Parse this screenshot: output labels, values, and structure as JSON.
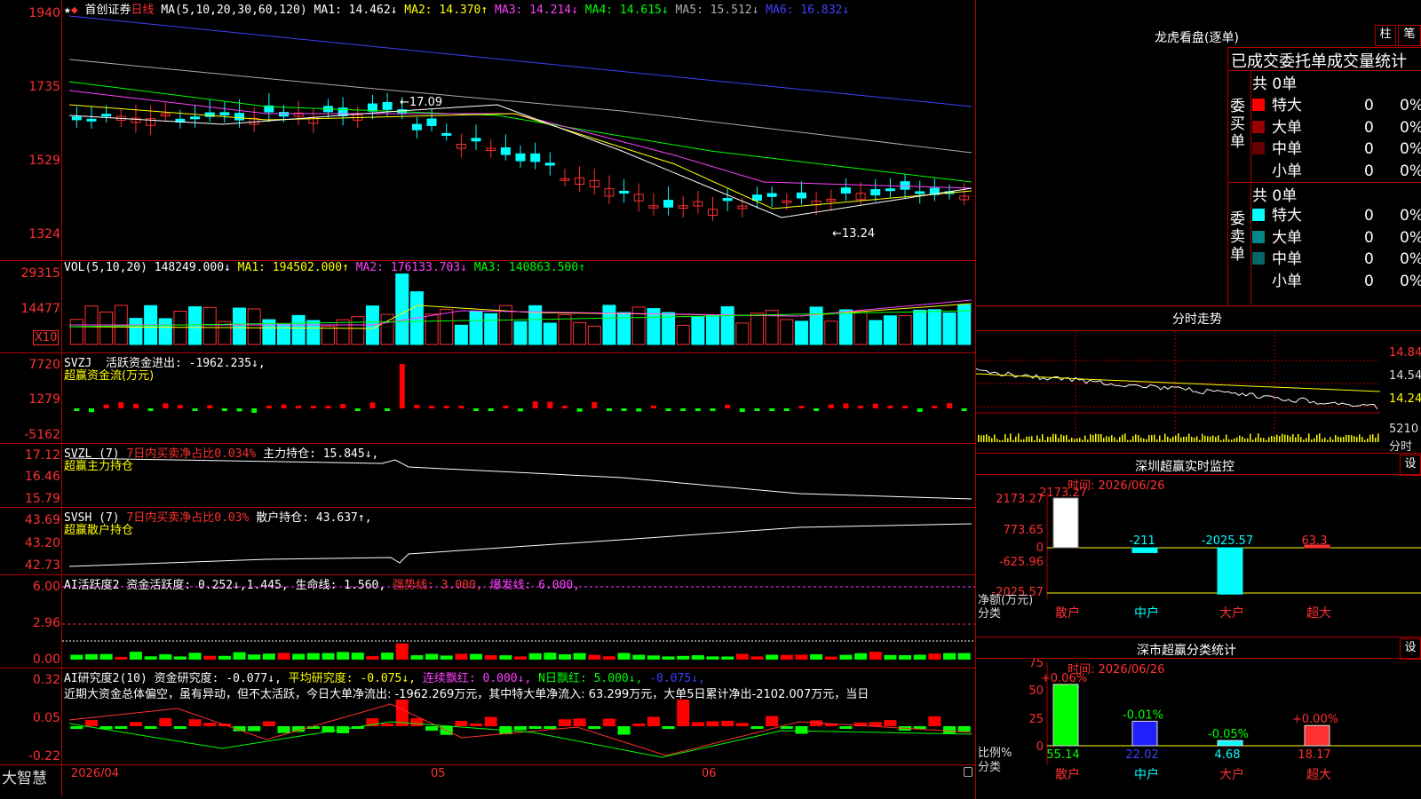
{
  "stock": {
    "name": "首创证券",
    "period": "日线",
    "ma_spec": "MA(5,10,20,30,60,120)",
    "ma": [
      {
        "k": "MA1: 14.462↓",
        "c": "#ffffff"
      },
      {
        "k": "MA2: 14.370↑",
        "c": "#ffff00"
      },
      {
        "k": "MA3: 14.214↓",
        "c": "#ff40ff"
      },
      {
        "k": "MA4: 14.615↓",
        "c": "#00ff00"
      },
      {
        "k": "MA5: 15.512↓",
        "c": "#aaaaaa"
      },
      {
        "k": "MA6: 16.832↓",
        "c": "#4040ff"
      }
    ],
    "yticks": [
      "1940",
      "1735",
      "1529",
      "1324"
    ],
    "high_label": "←17.09",
    "low_label": "←13.24"
  },
  "vol": {
    "hdr": "VOL(5,10,20)",
    "val": "148249.000↓",
    "ma": [
      {
        "k": "MA1: 194502.000↑",
        "c": "#ffff00"
      },
      {
        "k": "MA2: 176133.703↓",
        "c": "#ff40ff"
      },
      {
        "k": "MA3: 140863.500↑",
        "c": "#00ff00"
      }
    ],
    "yticks": [
      "29315",
      "14477"
    ],
    "unit": "X10"
  },
  "svzj": {
    "hdr": "SVZJ",
    "label": "活跃资金进出: -1962.235↓,",
    "sub": "超赢资金流(万元)",
    "yticks": [
      "7720",
      "1279",
      "-5162"
    ]
  },
  "svzl": {
    "hdr": "SVZL (7)",
    "ratio": "7日内买卖净占比0.034%",
    "label": "主力持仓: 15.845↓,",
    "sub": "超赢主力持仓",
    "yticks": [
      "17.12",
      "16.46",
      "15.79"
    ]
  },
  "svsh": {
    "hdr": "SVSH (7)",
    "ratio": "7日内买卖净占比0.03%",
    "label": "散户持仓: 43.637↑,",
    "sub": "超赢散户持仓",
    "yticks": [
      "43.69",
      "43.20",
      "42.73"
    ]
  },
  "ai1": {
    "hdr": "AI活跃度2",
    "a": "资金活跃度: 0.252↓,",
    "b": "1.445,",
    "c": "生命线: 1.560,",
    "d": "强势线: 3.000,",
    "e": "爆发线: 6.000,",
    "yticks": [
      "6.00",
      "2.96",
      "0.00"
    ]
  },
  "ai2": {
    "hdr": "AI研究度2(10)",
    "a": "资金研究度: -0.077↓,",
    "b": "平均研究度: -0.075↓,",
    "c": "连续飘红: 0.000↓,",
    "d": "N日飘红: 5.000↓,",
    "e": "-0.075↓,",
    "comment": "近期大资金总体偏空，虽有异动，但不太活跃，今日大单净流出: -1962.269万元，其中特大单净流入: 63.299万元，大单5日累计净出-2102.007万元，当日",
    "yticks": [
      "0.32",
      "0.05",
      "-0.22"
    ]
  },
  "xaxis": {
    "brand": "大智慧",
    "labels": [
      "2026/04",
      "05",
      "06"
    ]
  },
  "dragon": {
    "title": "龙虎看盘(逐单)",
    "btn1": "柱",
    "btn2": "笔",
    "table_title": "已成交委托单成交量统计",
    "buy_side": "委买单",
    "sell_side": "委卖单",
    "buy_total": "共 0单",
    "sell_total": "共 0单",
    "buy_rows": [
      {
        "n": "特大",
        "v": "0",
        "p": "0%",
        "c": "#ff0000"
      },
      {
        "n": "大单",
        "v": "0",
        "p": "0%",
        "c": "#990000"
      },
      {
        "n": "中单",
        "v": "0",
        "p": "0%",
        "c": "#660000"
      },
      {
        "n": "小单",
        "v": "0",
        "p": "0%",
        "c": "#000000"
      }
    ],
    "sell_rows": [
      {
        "n": "特大",
        "v": "0",
        "p": "0%",
        "c": "#00ffff"
      },
      {
        "n": "大单",
        "v": "0",
        "p": "0%",
        "c": "#008888"
      },
      {
        "n": "中单",
        "v": "0",
        "p": "0%",
        "c": "#006666"
      },
      {
        "n": "小单",
        "v": "0",
        "p": "0%",
        "c": "#000000"
      }
    ]
  },
  "intraday": {
    "title": "分时走势",
    "yticks": [
      "14.84",
      "14.54",
      "14.24",
      "5210"
    ],
    "xl": "分时"
  },
  "monitor": {
    "title": "深圳超赢实时监控",
    "btn": "设",
    "time": "时间: 2026/06/26",
    "yticks": [
      "2173.27",
      "773.65",
      "0",
      "-625.96",
      "-2025.57"
    ],
    "ylabel": "净额(万元)",
    "xlabel": "分类",
    "cats": [
      "散户",
      "中户",
      "大户",
      "超大"
    ],
    "values": [
      "2173.27",
      "-211",
      "-2025.57",
      "63.3"
    ]
  },
  "classify": {
    "title": "深市超赢分类统计",
    "btn": "设",
    "time": "时间: 2026/06/26",
    "yticks": [
      "75",
      "50",
      "25",
      "0"
    ],
    "ylabel": "比例%",
    "xlabel": "分类",
    "cats": [
      "散户",
      "中户",
      "大户",
      "超大"
    ],
    "changes": [
      "+0.06%",
      "-0.01%",
      "-0.05%",
      "+0.00%"
    ],
    "values": [
      "55.14",
      "22.02",
      "4.68",
      "18.17"
    ]
  },
  "chart_data": [
    {
      "type": "bar",
      "title": "深圳超赢实时监控",
      "categories": [
        "散户",
        "中户",
        "大户",
        "超大"
      ],
      "values": [
        2173.27,
        -211,
        -2025.57,
        63.3
      ],
      "ylabel": "净额(万元)",
      "xlabel": "分类",
      "ylim": [
        -2025.57,
        2173.27
      ]
    },
    {
      "type": "bar",
      "title": "深市超赢分类统计",
      "categories": [
        "散户",
        "中户",
        "大户",
        "超大"
      ],
      "values": [
        55.14,
        22.02,
        4.68,
        18.17
      ],
      "ylabel": "比例%",
      "xlabel": "分类",
      "ylim": [
        0,
        75
      ]
    }
  ]
}
